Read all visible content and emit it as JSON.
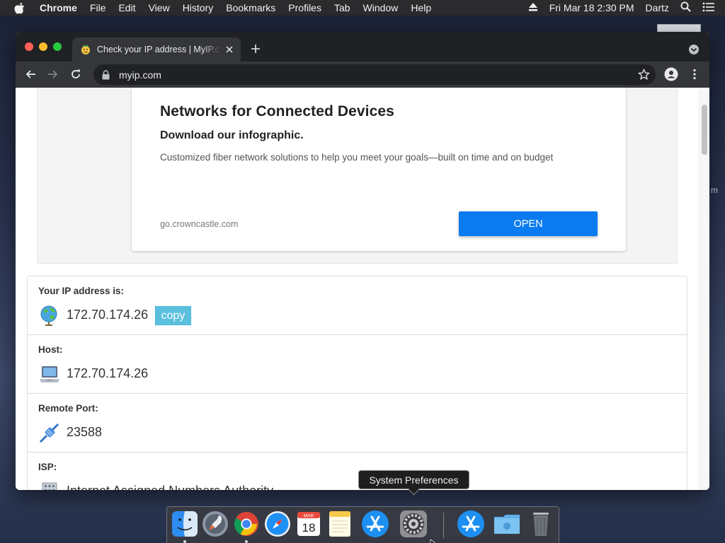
{
  "menubar": {
    "app_name": "Chrome",
    "items": [
      "File",
      "Edit",
      "View",
      "History",
      "Bookmarks",
      "Profiles",
      "Tab",
      "Window",
      "Help"
    ],
    "datetime": "Fri Mar 18  2:30 PM",
    "user": "Dartz"
  },
  "browser": {
    "tab_title": "Check your IP address | MyIP.com",
    "url": "myip.com"
  },
  "ad": {
    "title": "Networks for Connected Devices",
    "subtitle": "Download our infographic.",
    "description": "Customized fiber network solutions to help you meet your goals—built on time and on budget",
    "domain": "go.crowncastle.com",
    "button_label": "OPEN"
  },
  "info": {
    "ip_label": "Your IP address is:",
    "ip_value": "172.70.174.26",
    "copy_label": "copy",
    "host_label": "Host:",
    "host_value": "172.70.174.26",
    "port_label": "Remote Port:",
    "port_value": "23588",
    "isp_label": "ISP:",
    "isp_value": "Internet Assigned Numbers Authority"
  },
  "dock": {
    "tooltip": "System Preferences",
    "calendar_month": "MAR",
    "calendar_day": "18",
    "items": [
      "finder-icon",
      "launchpad-icon",
      "chrome-icon",
      "safari-icon",
      "calendar-icon",
      "notes-icon",
      "app-store-icon",
      "system-preferences-icon",
      "app-store-download-icon",
      "downloads-folder-icon",
      "trash-icon"
    ]
  },
  "colors": {
    "open_button": "#0a7bf0",
    "copy_button": "#5bc0de",
    "menubar_bg": "#2b2b2d",
    "tabstrip_bg": "#202124"
  }
}
